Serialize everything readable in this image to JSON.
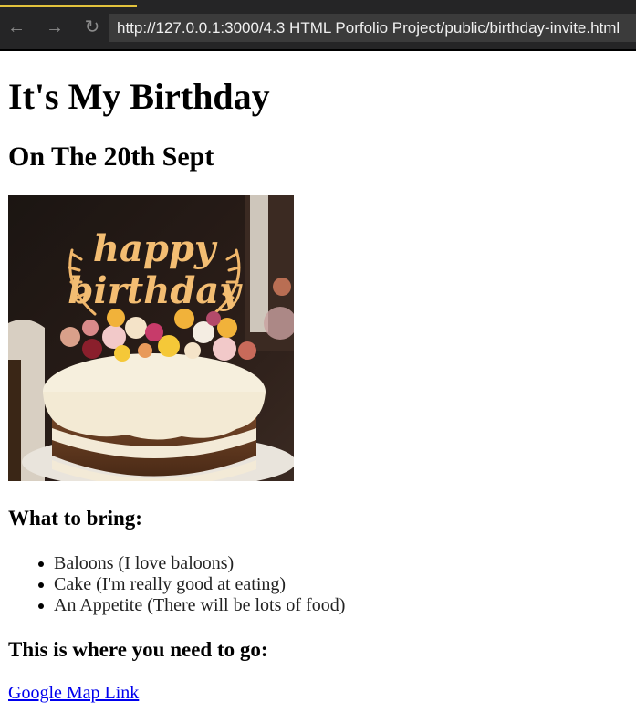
{
  "browser": {
    "url": "http://127.0.0.1:3000/4.3 HTML Porfolio Project/public/birthday-invite.html",
    "back_icon": "arrow-left-icon",
    "forward_icon": "arrow-right-icon",
    "reload_icon": "reload-icon",
    "back_glyph": "←",
    "forward_glyph": "→",
    "reload_glyph": "↻",
    "accent_color": "#e2c23c"
  },
  "page": {
    "title": "It's My Birthday",
    "date_heading": "On The 20th Sept",
    "image_topper": {
      "line1": "happy",
      "line2": "birthday"
    },
    "bring_heading": "What to bring:",
    "bring_items": [
      "Baloons (I love baloons)",
      "Cake (I'm really good at eating)",
      "An Appetite (There will be lots of food)"
    ],
    "location_heading": "This is where you need to go:",
    "map_link_text": "Google Map Link",
    "link_color": "#0000ee"
  }
}
